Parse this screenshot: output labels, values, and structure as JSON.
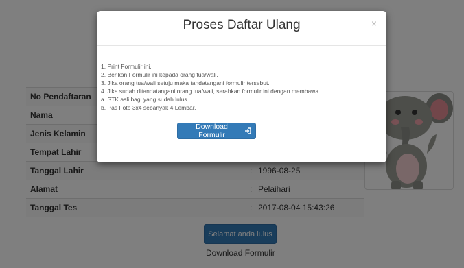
{
  "modal": {
    "title": "Proses Daftar Ulang",
    "close_label": "×",
    "instructions": [
      "1. Print Formulir ini.",
      "2. Berikan Formulir ini kepada orang tua/wali.",
      "3. Jika orang tua/wali setuju maka tandatangani formulir tersebut.",
      "4. Jika sudah ditandatangani orang tua/wali, serahkan formulir ini dengan membawa : .",
      "a. STK asli bagi yang sudah lulus.",
      "b. Pas Foto 3x4 sebanyak 4 Lembar."
    ],
    "download_button_label": "Download Formulir",
    "download_icon": "sign-in-icon"
  },
  "student_info": {
    "rows": [
      {
        "label": "No Pendaftaran",
        "value": ""
      },
      {
        "label": "Nama",
        "value": ""
      },
      {
        "label": "Jenis Kelamin",
        "value": ""
      },
      {
        "label": "Tempat Lahir",
        "value": ""
      },
      {
        "label": "Tanggal Lahir",
        "value": "1996-08-25"
      },
      {
        "label": "Alamat",
        "value": "Pelaihari"
      },
      {
        "label": "Tanggal Tes",
        "value": "2017-08-04 15:43:26"
      }
    ],
    "separator": ":"
  },
  "status_button_label": "Selamat anda lulus",
  "download_link_label": "Download Formulir",
  "colors": {
    "primary": "#337ab7",
    "backdrop": "rgba(0,0,0,0.5)"
  }
}
